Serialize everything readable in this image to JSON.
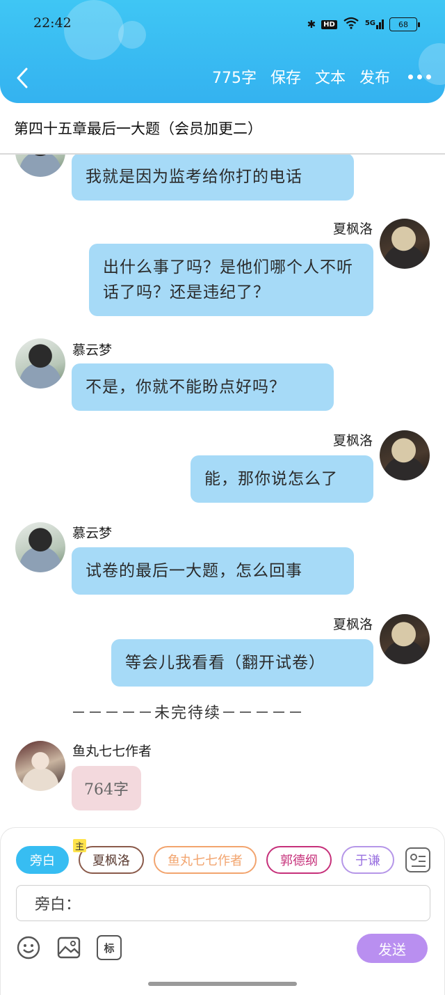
{
  "status_bar": {
    "time": "22:42",
    "bluetooth_icon": "✱",
    "hd": "HD",
    "wifi_icon": "wifi",
    "signal": "5G",
    "battery": "68"
  },
  "header": {
    "word_count": "775字",
    "save": "保存",
    "text": "文本",
    "publish": "发布"
  },
  "chapter_title": "第四十五章最后一大题（会员加更二）",
  "messages": [
    {
      "side": "left",
      "name": "",
      "text": "我就是因为监考给你打的电话"
    },
    {
      "side": "right",
      "name": "夏枫洛",
      "text": "出什么事了吗？是他们哪个人不听话了吗？还是违纪了？"
    },
    {
      "side": "left",
      "name": "慕云梦",
      "text": "不是，你就不能盼点好吗？"
    },
    {
      "side": "right",
      "name": "夏枫洛",
      "text": "能，那你说怎么了"
    },
    {
      "side": "left",
      "name": "慕云梦",
      "text": "试卷的最后一大题，怎么回事"
    },
    {
      "side": "right",
      "name": "夏枫洛",
      "text": "等会儿我看看（翻开试卷）"
    }
  ],
  "divider": "－－－－－未完待续－－－－－",
  "author_message": {
    "name": "鱼丸七七作者",
    "text": "764字"
  },
  "composer": {
    "roles": [
      "旁白",
      "夏枫洛",
      "鱼丸七七作者",
      "郭德纲",
      "于谦"
    ],
    "main_tag": "主",
    "input_value": "旁白：",
    "tool_label": "标",
    "send": "发送"
  }
}
